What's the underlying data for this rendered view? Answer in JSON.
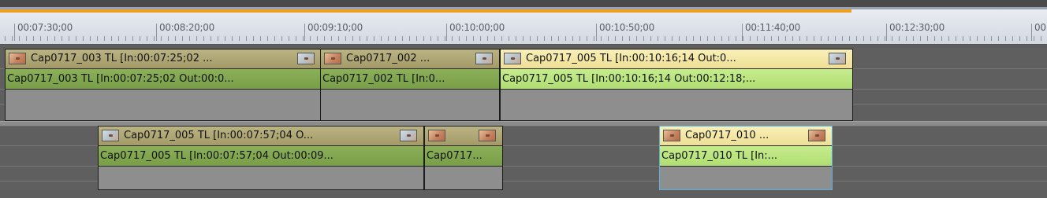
{
  "ruler": {
    "timecodes": [
      "00:07:30;00",
      "00:08:20;00",
      "00:09:10;00",
      "00:10:00;00",
      "00:10:50;00",
      "00:11:40;00",
      "00:12:30;00",
      "00"
    ],
    "progress_color": "#f0a020"
  },
  "tracks": [
    {
      "clips": [
        {
          "title": "Cap0717_003  TL [In:00:07:25;02 ...",
          "subtitle": "Cap0717_003  TL [In:00:07:25;02 Out:00:0...",
          "head": "olive",
          "body": "green",
          "thumb_left": "warm",
          "thumb_right": "cool",
          "selected": false
        },
        {
          "title": "Cap0717_002  ...",
          "subtitle": "Cap0717_002  TL [In:0...",
          "head": "olive",
          "body": "green",
          "thumb_left": "warm",
          "thumb_right": "cool",
          "selected": false
        },
        {
          "title": "Cap0717_005  TL [In:00:10:16;14 Out:0...",
          "subtitle": "Cap0717_005  TL [In:00:10:16;14 Out:00:12:18;...",
          "head": "yellow",
          "body": "light",
          "thumb_left": "cool",
          "thumb_right": "cool",
          "selected": false
        }
      ]
    },
    {
      "clips": [
        {
          "title": "Cap0717_005  TL [In:00:07:57;04 O...",
          "subtitle": "Cap0717_005  TL [In:00:07:57;04 Out:00:09...",
          "head": "olive",
          "body": "green",
          "thumb_left": "cool",
          "thumb_right": "cool",
          "selected": false
        },
        {
          "title": "",
          "subtitle": "Cap0717...",
          "head": "olive",
          "body": "green",
          "thumb_left": "warm",
          "thumb_right": "warm",
          "selected": false
        },
        {
          "title": "Cap0717_010 ...",
          "subtitle": "Cap0717_010  TL [In:...",
          "head": "yellow",
          "body": "light",
          "thumb_left": "warm",
          "thumb_right": "warm",
          "selected": true
        }
      ]
    }
  ]
}
